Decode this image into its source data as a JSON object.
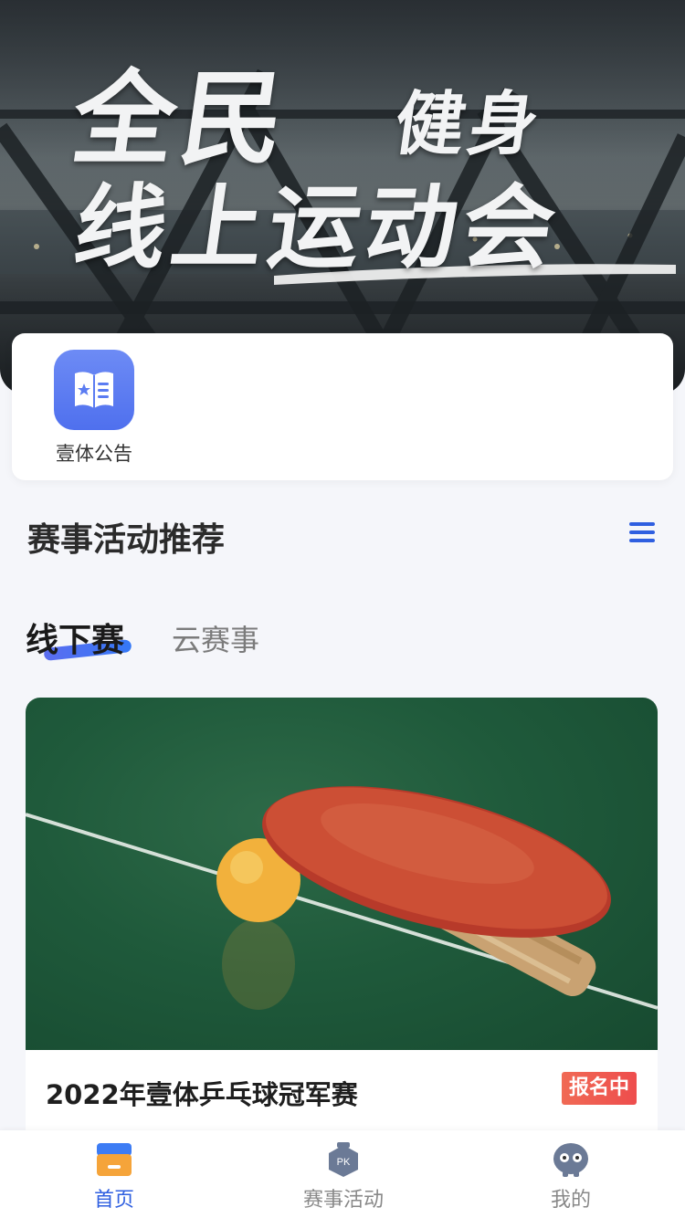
{
  "hero": {
    "line1_big": "全民",
    "line1_small": "健身",
    "line2": "线上运动会"
  },
  "quick_entries": [
    {
      "label": "壹体公告",
      "icon": "announcement-book-icon"
    }
  ],
  "section": {
    "title": "赛事活动推荐",
    "menu_icon": "list-menu-icon"
  },
  "tabs": [
    {
      "label": "线下赛",
      "active": true
    },
    {
      "label": "云赛事",
      "active": false
    }
  ],
  "event_card": {
    "title": "2022年壹体乒乓球冠军赛",
    "badge": "报名中",
    "image": "table-tennis-paddle-and-ball"
  },
  "tabbar": [
    {
      "label": "首页",
      "icon": "home-icon",
      "active": true
    },
    {
      "label": "赛事活动",
      "icon": "pk-badge-icon",
      "active": false
    },
    {
      "label": "我的",
      "icon": "profile-mascot-icon",
      "active": false
    }
  ],
  "colors": {
    "accent_blue": "#2f5fe0",
    "badge_red": "#ee4d4d",
    "icon_blue": "#5b7cf2",
    "background": "#f5f6fa"
  }
}
